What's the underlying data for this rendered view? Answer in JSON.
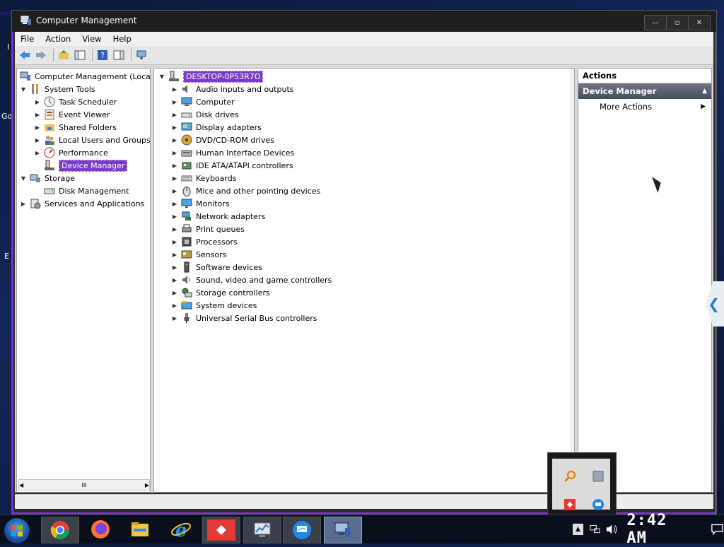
{
  "window": {
    "title": "Computer Management",
    "min": "—",
    "max": "▫",
    "close": "✕"
  },
  "menu": [
    "File",
    "Action",
    "View",
    "Help"
  ],
  "tree": {
    "root": "Computer Management (Local)",
    "system_tools": "System Tools",
    "task_scheduler": "Task Scheduler",
    "event_viewer": "Event Viewer",
    "shared_folders": "Shared Folders",
    "local_users": "Local Users and Groups",
    "performance": "Performance",
    "device_manager": "Device Manager",
    "storage": "Storage",
    "disk_management": "Disk Management",
    "services": "Services and Applications",
    "scroll_thumb": "III"
  },
  "devices": {
    "computer_name": "DESKTOP-0P53R7O",
    "categories": [
      "Audio inputs and outputs",
      "Computer",
      "Disk drives",
      "Display adapters",
      "DVD/CD-ROM drives",
      "Human Interface Devices",
      "IDE ATA/ATAPI controllers",
      "Keyboards",
      "Mice and other pointing devices",
      "Monitors",
      "Network adapters",
      "Print queues",
      "Processors",
      "Sensors",
      "Software devices",
      "Sound, video and game controllers",
      "Storage controllers",
      "System devices",
      "Universal Serial Bus controllers"
    ]
  },
  "actions": {
    "header": "Actions",
    "group": "Device Manager",
    "more": "More Actions"
  },
  "taskbar": {
    "clock": "2:42 AM"
  },
  "desktop_letters": [
    "I",
    "Go",
    "E"
  ],
  "colors": {
    "selection": "#7a3cc7",
    "accent_border": "#7b36c0"
  }
}
